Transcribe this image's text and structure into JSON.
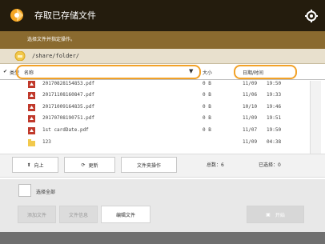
{
  "header": {
    "title": "存取已存储文件",
    "logo_icon": "canon-logo-icon",
    "settings_icon": "gear-icon"
  },
  "instruction": "选择文件并指定操作。",
  "path": "/share/folder/",
  "table": {
    "columns": {
      "type": "类型",
      "name": "名称",
      "size": "大小",
      "date": "日期/时间"
    },
    "rows": [
      {
        "icon": "pdf-icon",
        "name": "20170828154853.pdf",
        "size": "0 B",
        "date": "11/09",
        "time": "19:50"
      },
      {
        "icon": "pdf-icon",
        "name": "20171108160847.pdf",
        "size": "0 B",
        "date": "11/06",
        "time": "19:33"
      },
      {
        "icon": "pdf-icon",
        "name": "20171009164835.pdf",
        "size": "0 B",
        "date": "10/10",
        "time": "19:46"
      },
      {
        "icon": "pdf-icon",
        "name": "20170708190751.pdf",
        "size": "0 B",
        "date": "11/09",
        "time": "19:51"
      },
      {
        "icon": "pdf-icon",
        "name": "1st cardDate.pdf",
        "size": "0 B",
        "date": "11/07",
        "time": "19:50"
      },
      {
        "icon": "folder-icon",
        "name": "123",
        "size": "",
        "date": "11/09",
        "time": "04:38"
      }
    ]
  },
  "toolbar": {
    "up_label": "向上",
    "refresh_label": "更新",
    "file_ops_label": "文件夹操作",
    "total_label": "总数：",
    "total_value": "6",
    "selected_label": "已选择：",
    "selected_value": "0"
  },
  "bottom": {
    "select_all_label": "选择全部",
    "btn1": "添加文件",
    "btn2": "文件信息",
    "btn3": "编辑文件",
    "start_label": "开始"
  },
  "colors": {
    "accent": "#f2a228",
    "title_bg": "#241c0d",
    "instr_bg": "#8a6a2f"
  }
}
